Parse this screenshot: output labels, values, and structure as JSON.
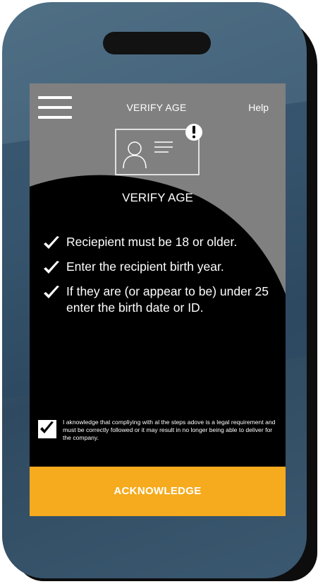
{
  "header": {
    "menu_icon": "hamburger-menu-icon",
    "title": "VERIFY AGE",
    "help_label": "Help"
  },
  "card": {
    "icon": "id-card-icon",
    "badge_icon": "exclamation-badge-icon",
    "title": "VERIFY AGE"
  },
  "checklist": {
    "icon": "checkmark-icon",
    "items": [
      "Reciepient must be 18 or older.",
      "Enter the recipient birth year.",
      "If they are (or appear to be) under 25 enter the birth date or ID."
    ]
  },
  "acknowledgement": {
    "checked": true,
    "text": "I aknowledge that compliying with al the steps adove is a legal requirement and must be correctly followed or it may result in no longer being able to deliver for the company."
  },
  "button": {
    "label": "ACKNOWLEDGE"
  },
  "colors": {
    "phone_body": "#43627a",
    "screen_grey": "#808080",
    "screen_black": "#000000",
    "accent": "#f5ab1d",
    "text": "#ffffff"
  }
}
